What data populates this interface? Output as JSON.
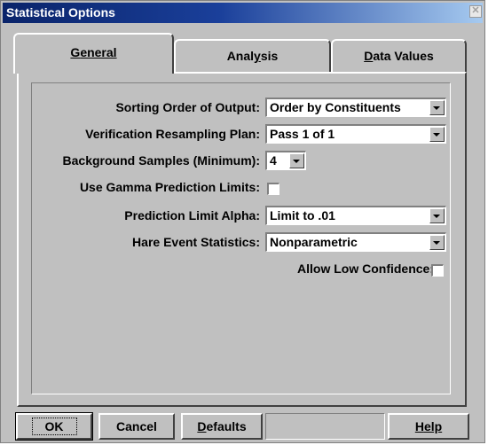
{
  "window": {
    "title": "Statistical Options"
  },
  "tabs": [
    {
      "label_u": "G",
      "label_rest": "eneral"
    },
    {
      "label_pre": "Anal",
      "label_u": "y",
      "label_rest": "sis"
    },
    {
      "label_u": "D",
      "label_rest": "ata Values"
    }
  ],
  "fields": {
    "sorting_order": {
      "label": "Sorting Order of Output:",
      "value": "Order by Constituents"
    },
    "verification_plan": {
      "label": "Verification Resampling Plan:",
      "value": "Pass 1 of 1"
    },
    "background_samples": {
      "label": "Background Samples (Minimum):",
      "value": "4"
    },
    "gamma_limits": {
      "label": "Use Gamma Prediction Limits:",
      "checked": false
    },
    "limit_alpha": {
      "label": "Prediction Limit Alpha:",
      "value": "Limit to .01"
    },
    "rare_event": {
      "label": "Hare Event Statistics:",
      "value": "Nonparametric"
    },
    "low_confidence": {
      "label": "Allow Low Confidence:",
      "checked": false
    }
  },
  "buttons": {
    "ok": "OK",
    "cancel": "Cancel",
    "defaults_u": "D",
    "defaults_rest": "efaults",
    "help_u": "H",
    "help_rest": "elp"
  }
}
